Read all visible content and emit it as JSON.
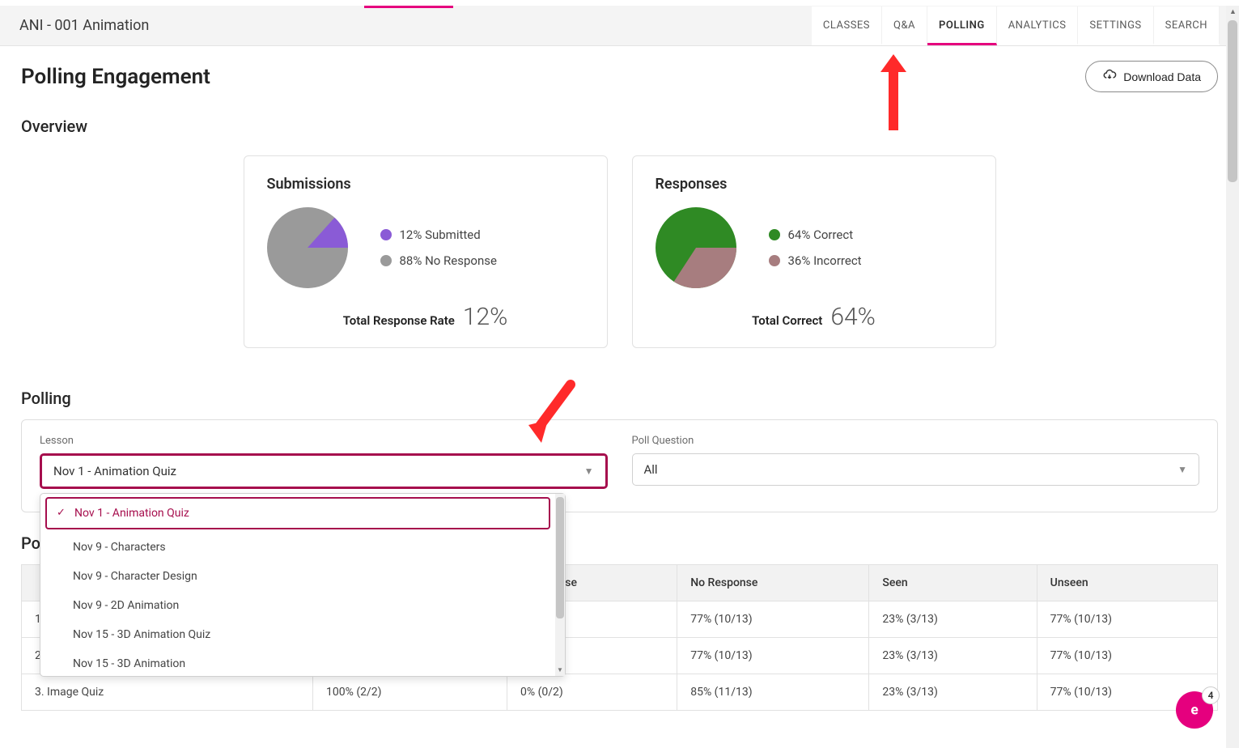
{
  "course_title": "ANI - 001 Animation",
  "tabs": [
    "CLASSES",
    "Q&A",
    "POLLING",
    "ANALYTICS",
    "SETTINGS",
    "SEARCH"
  ],
  "active_tab": "POLLING",
  "page_title": "Polling Engagement",
  "download_label": "Download Data",
  "overview_heading": "Overview",
  "submissions": {
    "title": "Submissions",
    "legend": [
      {
        "label": "12% Submitted",
        "color": "#8a5bd6"
      },
      {
        "label": "88% No Response",
        "color": "#9a9a9a"
      }
    ],
    "foot_label": "Total Response Rate",
    "foot_value": "12%"
  },
  "responses": {
    "title": "Responses",
    "legend": [
      {
        "label": "64% Correct",
        "color": "#2f8a24"
      },
      {
        "label": "36% Incorrect",
        "color": "#a77d7f"
      }
    ],
    "foot_label": "Total Correct",
    "foot_value": "64%"
  },
  "chart_data": [
    {
      "type": "pie",
      "title": "Submissions",
      "series": [
        {
          "name": "Submitted",
          "value": 12,
          "color": "#8a5bd6"
        },
        {
          "name": "No Response",
          "value": 88,
          "color": "#9a9a9a"
        }
      ]
    },
    {
      "type": "pie",
      "title": "Responses",
      "series": [
        {
          "name": "Correct",
          "value": 64,
          "color": "#2f8a24"
        },
        {
          "name": "Incorrect",
          "value": 36,
          "color": "#a77d7f"
        }
      ]
    }
  ],
  "polling_heading": "Polling",
  "lesson_label": "Lesson",
  "lesson_selected": "Nov 1 - Animation Quiz",
  "lesson_options": [
    "Nov 1 - Animation Quiz",
    "Nov 9 - Characters",
    "Nov 9 - Character Design",
    "Nov 9 - 2D Animation",
    "Nov 15 - 3D Animation Quiz",
    "Nov 15 - 3D Animation"
  ],
  "poll_question_label": "Poll Question",
  "poll_question_selected": "All",
  "results_heading": "Po",
  "table": {
    "headers": [
      "",
      "",
      "t Response",
      "No Response",
      "Seen",
      "Unseen"
    ],
    "rows": [
      [
        "1",
        "",
        "",
        "77% (10/13)",
        "23% (3/13)",
        "77% (10/13)"
      ],
      [
        "2",
        "",
        "",
        "77% (10/13)",
        "23% (3/13)",
        "77% (10/13)"
      ],
      [
        "3. Image Quiz",
        "100% (2/2)",
        "0% (0/2)",
        "85% (11/13)",
        "23% (3/13)",
        "77% (10/13)"
      ]
    ]
  },
  "fab_badge": "4"
}
